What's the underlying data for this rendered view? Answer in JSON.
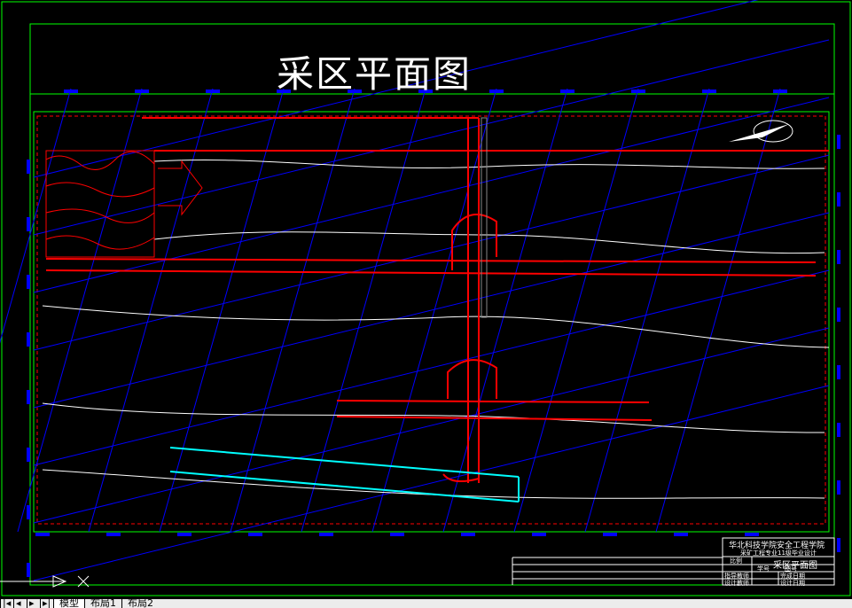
{
  "drawing": {
    "title": "采区平面图",
    "colors": {
      "frame": "#00ff00",
      "grid": "#0000ff",
      "roadway": "#ff0000",
      "contour": "#ffffff",
      "face": "#00ffff"
    }
  },
  "title_block": {
    "school": "华北科技学院安全工程学院",
    "subtitle": "采矿工程专业11级毕业设计",
    "drawing_name": "采区平面图",
    "labels": {
      "scale": "比例",
      "student_no": "学号",
      "drawing_no": "图号",
      "advisor": "指导教师",
      "finish_date": "完成日期",
      "designer": "设计教师",
      "design_date": "设计日期"
    }
  },
  "tabs": [
    {
      "label": "模型",
      "active": true
    },
    {
      "label": "布局1",
      "active": false
    },
    {
      "label": "布局2",
      "active": false
    }
  ]
}
